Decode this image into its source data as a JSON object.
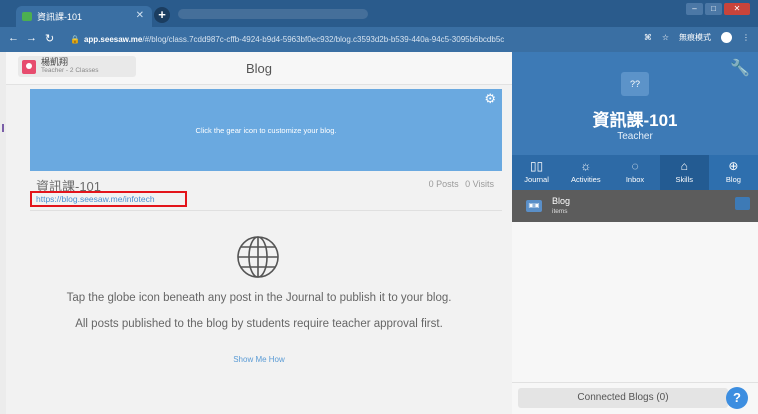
{
  "browser": {
    "tab_title": "資訊課-101",
    "tab_favicon": "green-square-icon",
    "url_host": "app.seesaw.me",
    "url_path": "/#/blog/class.7cdd987c-cffb-4924-b9d4-5963bf0ec932/blog.c3593d2b-b539-440a-94c5-3095b6bcdb5c",
    "incognito_label": "無痕模式"
  },
  "user": {
    "name": "楊凱翔",
    "role": "Teacher - 2 Classes"
  },
  "page": {
    "title": "Blog"
  },
  "banner": {
    "text": "Click the gear icon to customize your blog."
  },
  "class": {
    "name": "資訊課-101",
    "posts": "0 Posts",
    "visits": "0 Visits",
    "blog_url": "https://blog.seesaw.me/infotech"
  },
  "empty_state": {
    "line1": "Tap the globe icon beneath any post in the Journal to publish it to your blog.",
    "line2": "All posts published to the blog by students require teacher approval first.",
    "link": "Show Me How"
  },
  "sidebar": {
    "class_title": "資訊課-101",
    "role": "Teacher",
    "tabs": [
      {
        "label": "Journal",
        "icon": "book-icon"
      },
      {
        "label": "Activities",
        "icon": "lightbulb-icon"
      },
      {
        "label": "Inbox",
        "icon": "inbox-icon"
      },
      {
        "label": "Skills",
        "icon": "trophy-icon"
      },
      {
        "label": "Blog",
        "icon": "globe-icon"
      }
    ],
    "blog_item": {
      "title": "Blog",
      "subtitle": "items"
    },
    "connected_blogs": "Connected Blogs (0)",
    "help": "?"
  },
  "colors": {
    "brand_blue": "#3d7ab6",
    "banner_blue": "#6aa9e0",
    "highlight_red": "#e3141b"
  }
}
